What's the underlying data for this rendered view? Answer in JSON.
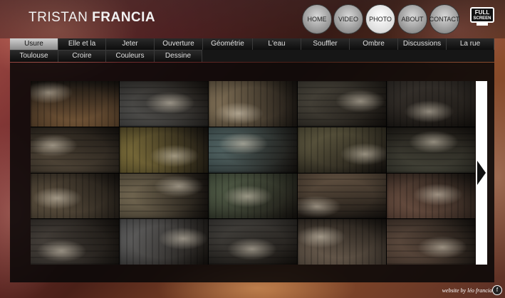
{
  "header": {
    "logo_first": "TRISTAN",
    "logo_last": "FRANCIA",
    "nav": [
      {
        "label": "HOME",
        "active": false
      },
      {
        "label": "VIDEO",
        "active": false
      },
      {
        "label": "PHOTO",
        "active": true
      },
      {
        "label": "ABOUT",
        "active": false
      },
      {
        "label": "CONTACT",
        "active": false
      }
    ],
    "fullscreen_line1": "FULL",
    "fullscreen_line2": "SCREEN"
  },
  "menu": {
    "row1": [
      "Usure",
      "Elle et la",
      "Jeter",
      "Ouverture",
      "Géométrie",
      "L'eau",
      "Souffler",
      "Ombre",
      "Discussions",
      "La rue"
    ],
    "row2": [
      "Toulouse",
      "Croire",
      "Couleurs",
      "Dessine"
    ],
    "active": "Usure"
  },
  "gallery": {
    "thumbnails": [
      {
        "icon": "photo-thumbnail",
        "tone": "#7a5a3a"
      },
      {
        "icon": "photo-thumbnail",
        "tone": "#5a5a58"
      },
      {
        "icon": "photo-thumbnail",
        "tone": "#8c7a5e"
      },
      {
        "icon": "photo-thumbnail",
        "tone": "#4e4a40"
      },
      {
        "icon": "photo-thumbnail",
        "tone": "#3a3530"
      },
      {
        "icon": "photo-thumbnail",
        "tone": "#5c5040"
      },
      {
        "icon": "photo-thumbnail",
        "tone": "#8a7a40"
      },
      {
        "icon": "photo-thumbnail",
        "tone": "#5a7070"
      },
      {
        "icon": "photo-thumbnail",
        "tone": "#6a6448"
      },
      {
        "icon": "photo-thumbnail",
        "tone": "#4a4a3e"
      },
      {
        "icon": "photo-thumbnail",
        "tone": "#6a5c48"
      },
      {
        "icon": "photo-thumbnail",
        "tone": "#7c7058"
      },
      {
        "icon": "photo-thumbnail",
        "tone": "#5a6850"
      },
      {
        "icon": "photo-thumbnail",
        "tone": "#6c5a48"
      },
      {
        "icon": "photo-thumbnail",
        "tone": "#7a5a4a"
      },
      {
        "icon": "photo-thumbnail",
        "tone": "#4c4640"
      },
      {
        "icon": "photo-thumbnail",
        "tone": "#6a6a6a"
      },
      {
        "icon": "photo-thumbnail",
        "tone": "#4a4844"
      },
      {
        "icon": "photo-thumbnail",
        "tone": "#7a6a5a"
      },
      {
        "icon": "photo-thumbnail",
        "tone": "#6a5446"
      }
    ],
    "next_icon": "arrow-right-icon"
  },
  "footer": {
    "credit": "website by léo francia",
    "credit_icon": "f-logo-icon",
    "credit_icon_glyph": "f"
  }
}
